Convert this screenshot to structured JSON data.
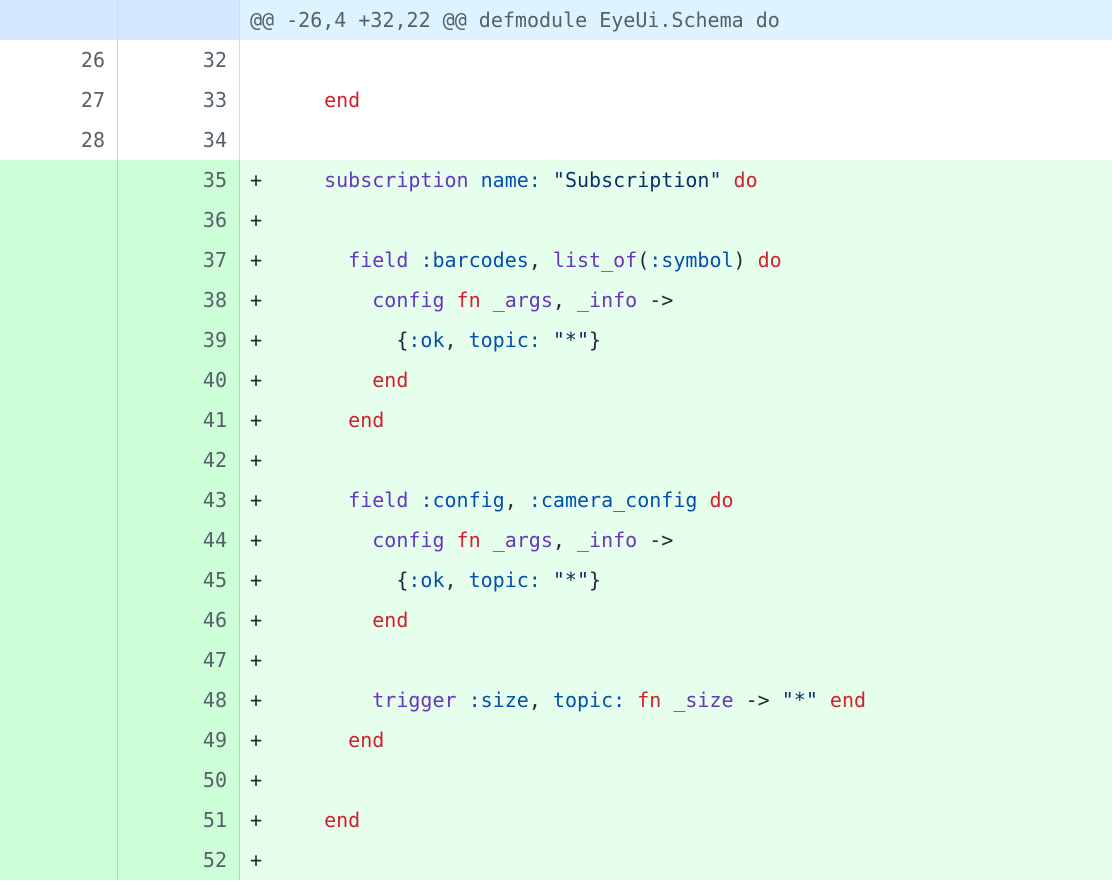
{
  "hunk": {
    "header": "@@ -26,4 +32,22 @@ defmodule EyeUi.Schema do"
  },
  "lines": [
    {
      "type": "ctx",
      "old": "26",
      "new": "32",
      "marker": "",
      "tokens": []
    },
    {
      "type": "ctx",
      "old": "27",
      "new": "33",
      "marker": "",
      "tokens": [
        {
          "t": "  ",
          "c": "pl"
        },
        {
          "t": "end",
          "c": "kw"
        }
      ]
    },
    {
      "type": "ctx",
      "old": "28",
      "new": "34",
      "marker": "",
      "tokens": []
    },
    {
      "type": "add",
      "old": "",
      "new": "35",
      "marker": "+",
      "tokens": [
        {
          "t": "  ",
          "c": "pl"
        },
        {
          "t": "subscription",
          "c": "fn"
        },
        {
          "t": " ",
          "c": "pl"
        },
        {
          "t": "name:",
          "c": "at"
        },
        {
          "t": " ",
          "c": "pl"
        },
        {
          "t": "\"Subscription\"",
          "c": "str"
        },
        {
          "t": " ",
          "c": "pl"
        },
        {
          "t": "do",
          "c": "kw"
        }
      ]
    },
    {
      "type": "add",
      "old": "",
      "new": "36",
      "marker": "+",
      "tokens": []
    },
    {
      "type": "add",
      "old": "",
      "new": "37",
      "marker": "+",
      "tokens": [
        {
          "t": "    ",
          "c": "pl"
        },
        {
          "t": "field",
          "c": "fn"
        },
        {
          "t": " ",
          "c": "pl"
        },
        {
          "t": ":barcodes",
          "c": "at"
        },
        {
          "t": ", ",
          "c": "pl"
        },
        {
          "t": "list_of",
          "c": "fn"
        },
        {
          "t": "(",
          "c": "pl"
        },
        {
          "t": ":symbol",
          "c": "at"
        },
        {
          "t": ") ",
          "c": "pl"
        },
        {
          "t": "do",
          "c": "kw"
        }
      ]
    },
    {
      "type": "add",
      "old": "",
      "new": "38",
      "marker": "+",
      "tokens": [
        {
          "t": "      ",
          "c": "pl"
        },
        {
          "t": "config",
          "c": "fn"
        },
        {
          "t": " ",
          "c": "pl"
        },
        {
          "t": "fn",
          "c": "kw"
        },
        {
          "t": " ",
          "c": "pl"
        },
        {
          "t": "_args",
          "c": "fn"
        },
        {
          "t": ", ",
          "c": "pl"
        },
        {
          "t": "_info",
          "c": "fn"
        },
        {
          "t": " ->",
          "c": "pl"
        }
      ]
    },
    {
      "type": "add",
      "old": "",
      "new": "39",
      "marker": "+",
      "tokens": [
        {
          "t": "        {",
          "c": "pl"
        },
        {
          "t": ":ok",
          "c": "at"
        },
        {
          "t": ", ",
          "c": "pl"
        },
        {
          "t": "topic:",
          "c": "at"
        },
        {
          "t": " ",
          "c": "pl"
        },
        {
          "t": "\"*\"",
          "c": "str"
        },
        {
          "t": "}",
          "c": "pl"
        }
      ]
    },
    {
      "type": "add",
      "old": "",
      "new": "40",
      "marker": "+",
      "tokens": [
        {
          "t": "      ",
          "c": "pl"
        },
        {
          "t": "end",
          "c": "kw"
        }
      ]
    },
    {
      "type": "add",
      "old": "",
      "new": "41",
      "marker": "+",
      "tokens": [
        {
          "t": "    ",
          "c": "pl"
        },
        {
          "t": "end",
          "c": "kw"
        }
      ]
    },
    {
      "type": "add",
      "old": "",
      "new": "42",
      "marker": "+",
      "tokens": []
    },
    {
      "type": "add",
      "old": "",
      "new": "43",
      "marker": "+",
      "tokens": [
        {
          "t": "    ",
          "c": "pl"
        },
        {
          "t": "field",
          "c": "fn"
        },
        {
          "t": " ",
          "c": "pl"
        },
        {
          "t": ":config",
          "c": "at"
        },
        {
          "t": ", ",
          "c": "pl"
        },
        {
          "t": ":camera_config",
          "c": "at"
        },
        {
          "t": " ",
          "c": "pl"
        },
        {
          "t": "do",
          "c": "kw"
        }
      ]
    },
    {
      "type": "add",
      "old": "",
      "new": "44",
      "marker": "+",
      "tokens": [
        {
          "t": "      ",
          "c": "pl"
        },
        {
          "t": "config",
          "c": "fn"
        },
        {
          "t": " ",
          "c": "pl"
        },
        {
          "t": "fn",
          "c": "kw"
        },
        {
          "t": " ",
          "c": "pl"
        },
        {
          "t": "_args",
          "c": "fn"
        },
        {
          "t": ", ",
          "c": "pl"
        },
        {
          "t": "_info",
          "c": "fn"
        },
        {
          "t": " ->",
          "c": "pl"
        }
      ]
    },
    {
      "type": "add",
      "old": "",
      "new": "45",
      "marker": "+",
      "tokens": [
        {
          "t": "        {",
          "c": "pl"
        },
        {
          "t": ":ok",
          "c": "at"
        },
        {
          "t": ", ",
          "c": "pl"
        },
        {
          "t": "topic:",
          "c": "at"
        },
        {
          "t": " ",
          "c": "pl"
        },
        {
          "t": "\"*\"",
          "c": "str"
        },
        {
          "t": "}",
          "c": "pl"
        }
      ]
    },
    {
      "type": "add",
      "old": "",
      "new": "46",
      "marker": "+",
      "tokens": [
        {
          "t": "      ",
          "c": "pl"
        },
        {
          "t": "end",
          "c": "kw"
        }
      ]
    },
    {
      "type": "add",
      "old": "",
      "new": "47",
      "marker": "+",
      "tokens": []
    },
    {
      "type": "add",
      "old": "",
      "new": "48",
      "marker": "+",
      "tokens": [
        {
          "t": "      ",
          "c": "pl"
        },
        {
          "t": "trigger",
          "c": "fn"
        },
        {
          "t": " ",
          "c": "pl"
        },
        {
          "t": ":size",
          "c": "at"
        },
        {
          "t": ", ",
          "c": "pl"
        },
        {
          "t": "topic:",
          "c": "at"
        },
        {
          "t": " ",
          "c": "pl"
        },
        {
          "t": "fn",
          "c": "kw"
        },
        {
          "t": " ",
          "c": "pl"
        },
        {
          "t": "_size",
          "c": "fn"
        },
        {
          "t": " -> ",
          "c": "pl"
        },
        {
          "t": "\"*\"",
          "c": "str"
        },
        {
          "t": " ",
          "c": "pl"
        },
        {
          "t": "end",
          "c": "kw"
        }
      ]
    },
    {
      "type": "add",
      "old": "",
      "new": "49",
      "marker": "+",
      "tokens": [
        {
          "t": "    ",
          "c": "pl"
        },
        {
          "t": "end",
          "c": "kw"
        }
      ]
    },
    {
      "type": "add",
      "old": "",
      "new": "50",
      "marker": "+",
      "tokens": []
    },
    {
      "type": "add",
      "old": "",
      "new": "51",
      "marker": "+",
      "tokens": [
        {
          "t": "  ",
          "c": "pl"
        },
        {
          "t": "end",
          "c": "kw"
        }
      ]
    },
    {
      "type": "add",
      "old": "",
      "new": "52",
      "marker": "+",
      "tokens": []
    }
  ],
  "colors": {
    "hunk_bg": "#ddf4ff",
    "add_bg": "#e6ffec",
    "add_num_bg": "#ccffd8",
    "keyword": "#cf222e",
    "function": "#6639ba",
    "atom": "#0550ae",
    "string": "#0a3069"
  }
}
